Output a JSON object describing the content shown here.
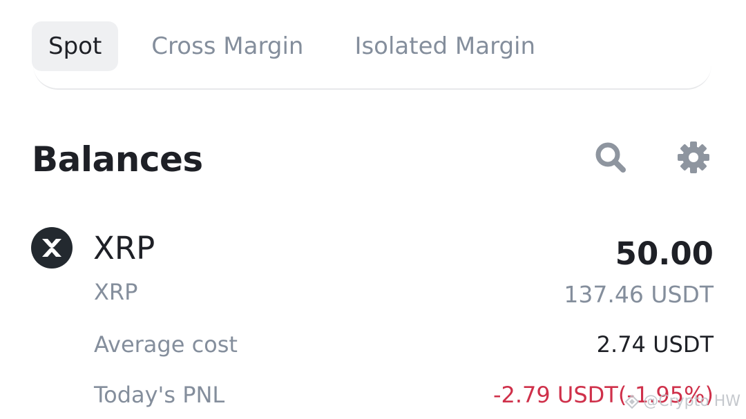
{
  "tabs": [
    {
      "label": "Spot",
      "active": true
    },
    {
      "label": "Cross Margin",
      "active": false
    },
    {
      "label": "Isolated Margin",
      "active": false
    }
  ],
  "header": {
    "title": "Balances",
    "icons": [
      "search-icon",
      "gear-icon"
    ]
  },
  "asset": {
    "logo_icon": "xrp-logo-icon",
    "symbol": "XRP",
    "name": "XRP",
    "amount": "50.00",
    "amount_usdt": "137.46 USDT",
    "average_cost_label": "Average cost",
    "average_cost_value": "2.74 USDT",
    "pnl_label": "Today's PNL",
    "pnl_value": "-2.79 USDT(-1.95%)"
  },
  "colors": {
    "primary_text": "#1e2026",
    "secondary_text": "#848e9c",
    "negative": "#cf304a",
    "active_tab_bg": "#eff0f2"
  },
  "watermark": {
    "icon": "binance-square-logo-icon",
    "text": "@Crypto HW"
  }
}
